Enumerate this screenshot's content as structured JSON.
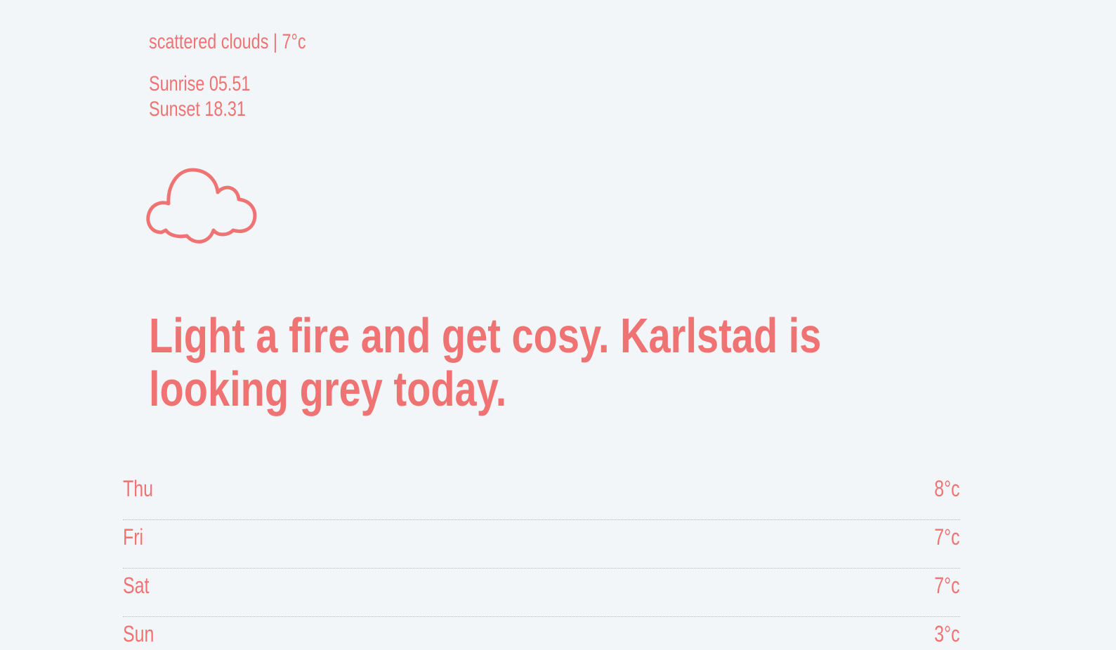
{
  "current": {
    "summary": "scattered clouds | 7°c",
    "sunrise": "Sunrise 05.51",
    "sunset": "Sunset 18.31"
  },
  "icon": "cloud-icon",
  "headline": "Light a fire and get cosy. Karlstad is looking grey today.",
  "forecast": [
    {
      "day": "Thu",
      "temp": "8°c"
    },
    {
      "day": "Fri",
      "temp": "7°c"
    },
    {
      "day": "Sat",
      "temp": "7°c"
    },
    {
      "day": "Sun",
      "temp": "3°c"
    }
  ],
  "colors": {
    "accent": "#f07373",
    "background": "#f2f6f8",
    "divider": "#b9b9b9"
  }
}
